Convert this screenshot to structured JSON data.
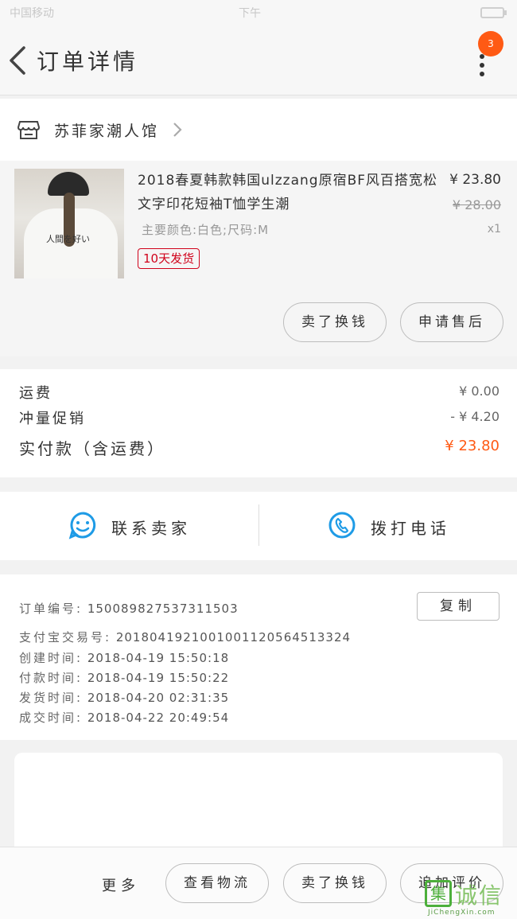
{
  "status_bar": {
    "carrier": "中国移动",
    "time": "下午"
  },
  "header": {
    "title": "订单详情",
    "badge_count": "3"
  },
  "shop": {
    "name": "苏菲家潮人馆"
  },
  "product": {
    "name": "2018春夏韩款韩国ulzzang原宿BF风百搭宽松文字印花短袖T恤学生潮",
    "spec": "主要颜色:白色;尺码:M",
    "shipping_tag": "10天发货",
    "price": "¥ 23.80",
    "original_price": "¥ 28.00",
    "quantity": "x1",
    "print_text": "人間を好い"
  },
  "item_actions": {
    "buy_again": "卖了换钱",
    "after_sale": "申请售后"
  },
  "fees": {
    "shipping_label": "运费",
    "shipping_value": "¥ 0.00",
    "promo_label": "冲量促销",
    "promo_value": "- ¥ 4.20",
    "total_label": "实付款（含运费）",
    "total_value": "¥ 23.80"
  },
  "contact": {
    "seller": "联系卖家",
    "call": "拨打电话"
  },
  "order_info": {
    "order_no_label": "订单编号:",
    "order_no": "150089827537311503",
    "copy_label": "复制",
    "alipay_label": "支付宝交易号:",
    "alipay_no": "2018041921001001120564513324",
    "created_label": "创建时间:",
    "created": "2018-04-19 15:50:18",
    "paid_label": "付款时间:",
    "paid": "2018-04-19 15:50:22",
    "shipped_label": "发货时间:",
    "shipped": "2018-04-20 02:31:35",
    "completed_label": "成交时间:",
    "completed": "2018-04-22 20:49:54"
  },
  "bottom_bar": {
    "more": "更多",
    "logistics": "查看物流",
    "sell": "卖了换钱",
    "review": "追加评价"
  },
  "watermark": {
    "char": "集",
    "name": "诚信",
    "url": "JiChengXin.com"
  },
  "colors": {
    "accent": "#ff5a14",
    "tag_red": "#d0021b",
    "contact_blue": "#1e9be6"
  },
  "icons": [
    "back-arrow-icon",
    "more-dots-icon",
    "shop-icon",
    "chevron-right-icon",
    "chat-smile-icon",
    "phone-icon"
  ]
}
